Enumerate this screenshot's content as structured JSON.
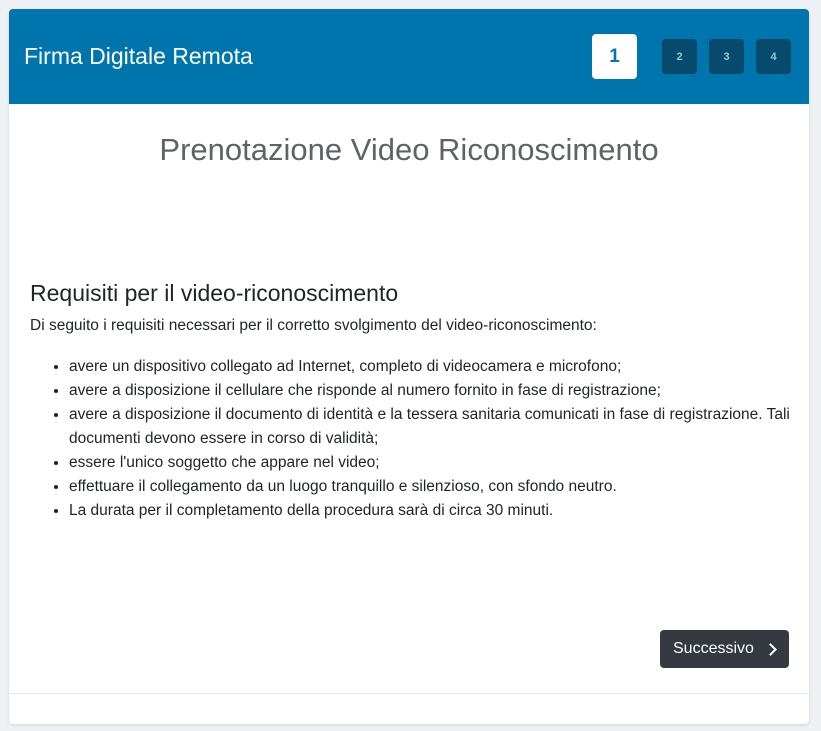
{
  "header": {
    "title": "Firma Digitale Remota",
    "steps": [
      {
        "label": "1",
        "active": true
      },
      {
        "label": "2",
        "active": false
      },
      {
        "label": "3",
        "active": false
      },
      {
        "label": "4",
        "active": false
      }
    ]
  },
  "main": {
    "page_title": "Prenotazione Video Riconoscimento",
    "section_title": "Requisiti per il video-riconoscimento",
    "intro": "Di seguito i requisiti necessari per il corretto svolgimento del video-riconoscimento:",
    "requirements": [
      "avere un dispositivo collegato ad Internet, completo di videocamera e microfono;",
      "avere a disposizione il cellulare che risponde al numero fornito in fase di registrazione;",
      "avere a disposizione il documento di identità e la tessera sanitaria comunicati in fase di registrazione. Tali documenti devono essere in corso di validità;",
      "essere l'unico soggetto che appare nel video;",
      "effettuare il collegamento da un luogo tranquillo e silenzioso, con sfondo neutro.",
      "La durata per il completamento della procedura sarà di circa 30 minuti."
    ]
  },
  "actions": {
    "next_label": "Successivo",
    "next_icon": "chevron-right-icon"
  },
  "colors": {
    "header_bg": "#0075ad",
    "step_inactive_bg": "#064a6c",
    "button_bg": "#343a40"
  }
}
